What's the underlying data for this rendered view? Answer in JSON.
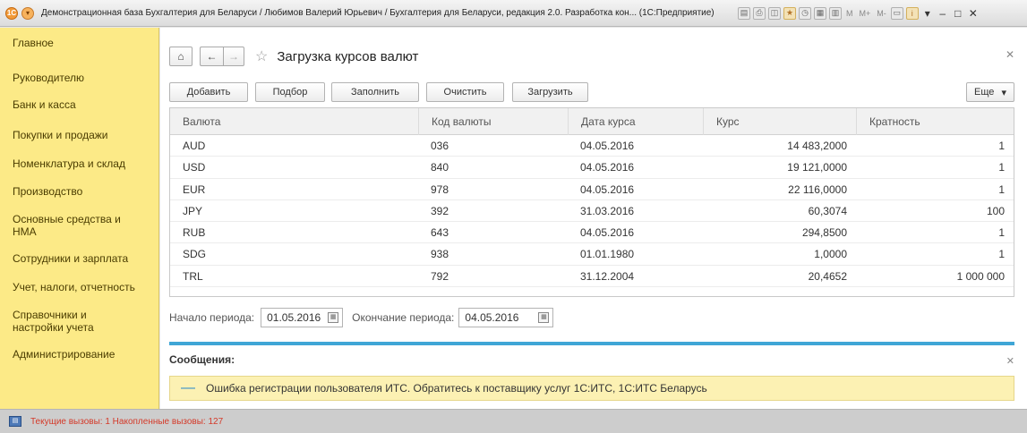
{
  "window": {
    "title": "Демонстрационная база Бухгалтерия для Беларуси / Любимов Валерий Юрьевич / Бухгалтерия для Беларуси, редакция 2.0. Разработка кон... (1С:Предприятие)",
    "mem_labels": [
      "M",
      "M+",
      "M-"
    ]
  },
  "sidebar": {
    "items": [
      "Главное",
      "Руководителю",
      "Банк и касса",
      "Покупки и продажи",
      "Номенклатура и склад",
      "Производство",
      "Основные средства и НМА",
      "Сотрудники и зарплата",
      "Учет, налоги, отчетность",
      "Справочники и настройки учета",
      "Администрирование"
    ]
  },
  "page": {
    "title": "Загрузка курсов валют"
  },
  "toolbar": {
    "add": "Добавить",
    "select": "Подбор",
    "fill": "Заполнить",
    "clear": "Очистить",
    "load": "Загрузить",
    "more": "Еще"
  },
  "table": {
    "columns": [
      "Валюта",
      "Код валюты",
      "Дата курса",
      "Курс",
      "Кратность"
    ],
    "rows": [
      [
        "AUD",
        "036",
        "04.05.2016",
        "14 483,2000",
        "1"
      ],
      [
        "USD",
        "840",
        "04.05.2016",
        "19 121,0000",
        "1"
      ],
      [
        "EUR",
        "978",
        "04.05.2016",
        "22 116,0000",
        "1"
      ],
      [
        "JPY",
        "392",
        "31.03.2016",
        "60,3074",
        "100"
      ],
      [
        "RUB",
        "643",
        "04.05.2016",
        "294,8500",
        "1"
      ],
      [
        "SDG",
        "938",
        "01.01.1980",
        "1,0000",
        "1"
      ],
      [
        "TRL",
        "792",
        "31.12.2004",
        "20,4652",
        "1 000 000"
      ]
    ]
  },
  "period": {
    "start_label": "Начало периода:",
    "start_value": "01.05.2016",
    "end_label": "Окончание периода:",
    "end_value": "04.05.2016"
  },
  "messages": {
    "title": "Сообщения:",
    "items": [
      "Ошибка регистрации пользователя ИТС. Обратитесь к поставщику услуг 1С:ИТС, 1С:ИТС Беларусь"
    ]
  },
  "status": {
    "text": "Текущие вызовы: 1   Накопленные вызовы: 127"
  },
  "colors": {
    "sidebar_bg": "#fcea87",
    "accent_blue": "#3fa6d6",
    "message_bg": "#fcf1b3",
    "status_red": "#d43a2a"
  }
}
